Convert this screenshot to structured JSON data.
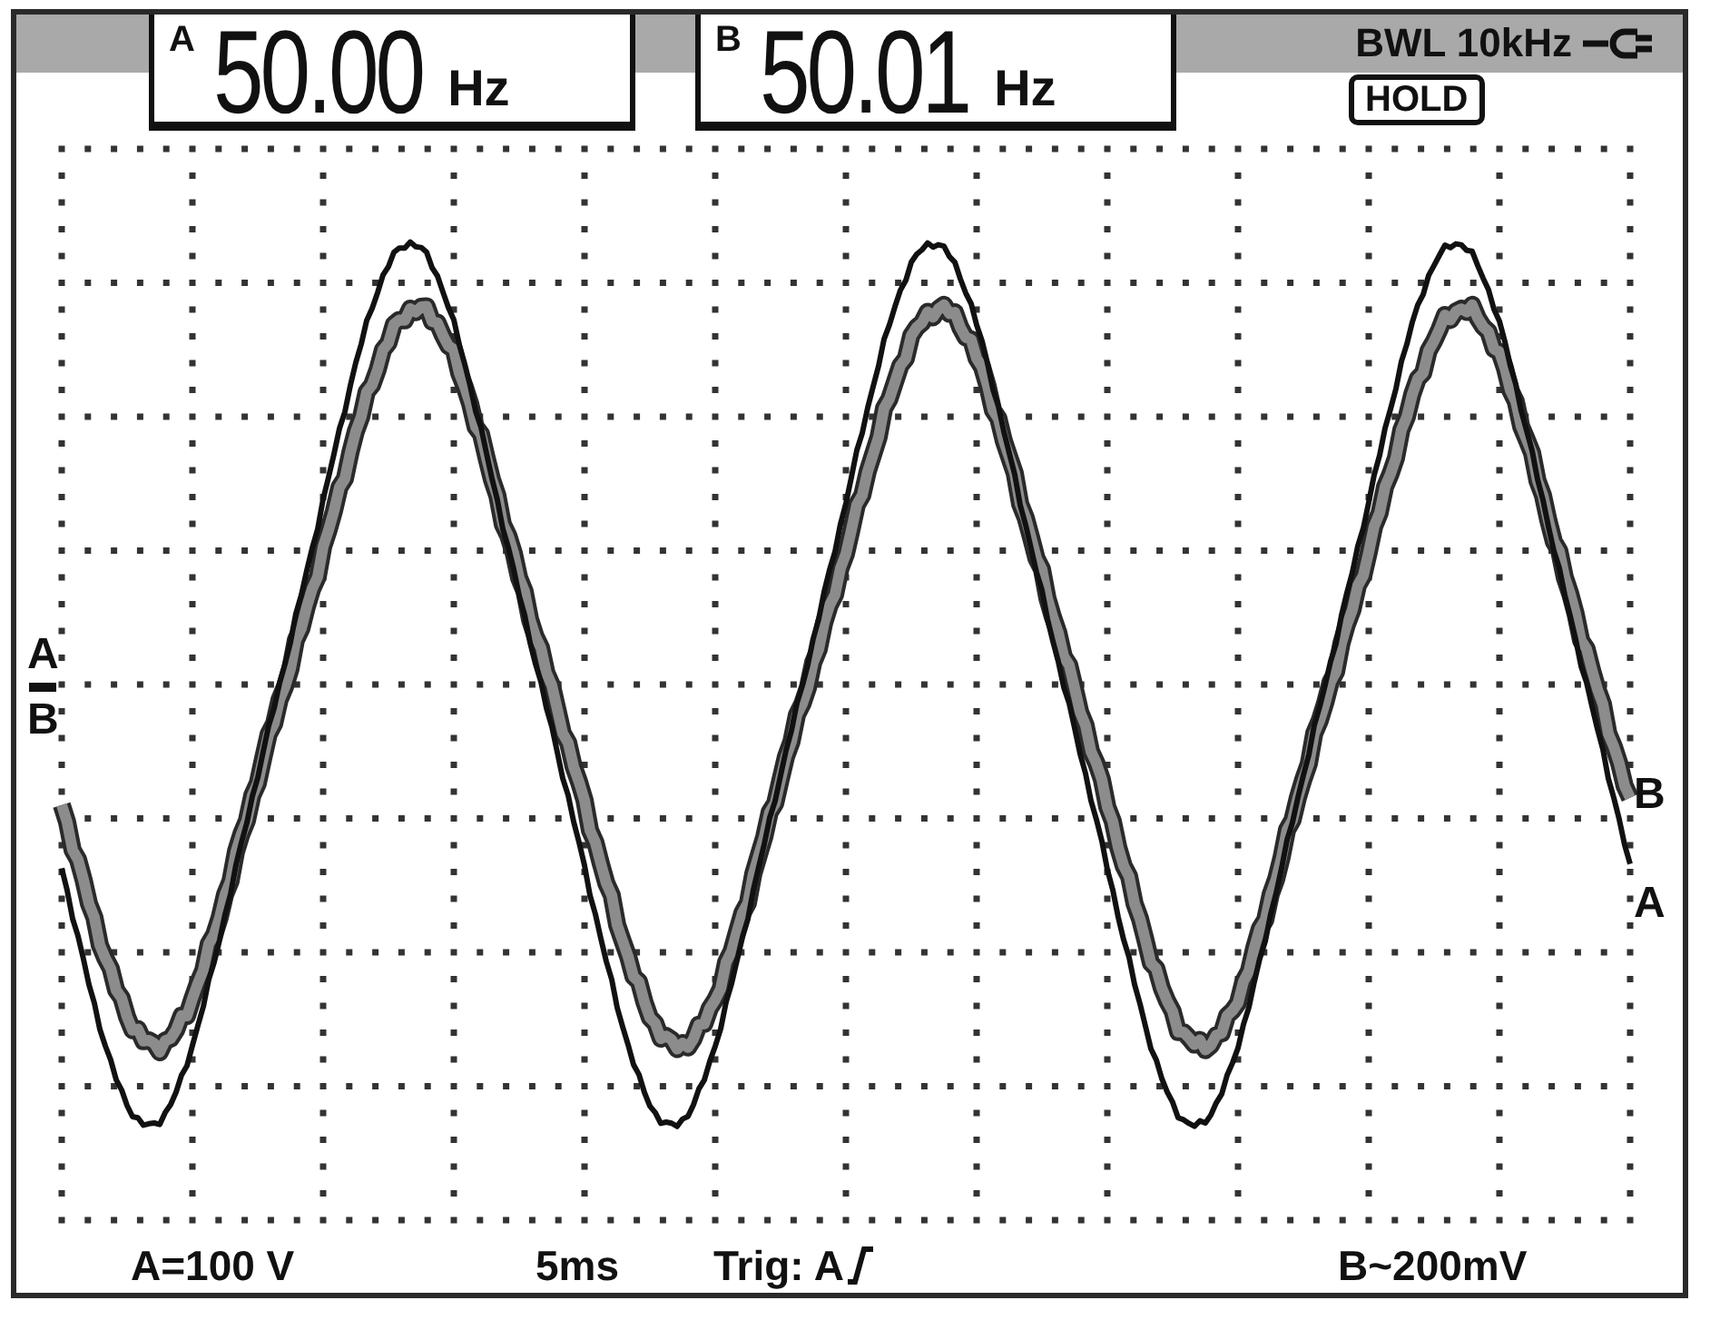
{
  "readouts": [
    {
      "channel": "A",
      "value": "50.00",
      "unit": "Hz"
    },
    {
      "channel": "B",
      "value": "50.01",
      "unit": "Hz"
    }
  ],
  "status": {
    "bandwidth_limit": "BWL 10kHz",
    "mode": "HOLD"
  },
  "ground_markers": [
    "A",
    "B"
  ],
  "traces": [
    {
      "label": "B",
      "kind": "thick"
    },
    {
      "label": "A",
      "kind": "thin"
    }
  ],
  "footer": {
    "scale_a": "A=100 V",
    "timebase": "5ms",
    "trigger": "Trig: A",
    "scale_b": "B~200mV"
  }
}
